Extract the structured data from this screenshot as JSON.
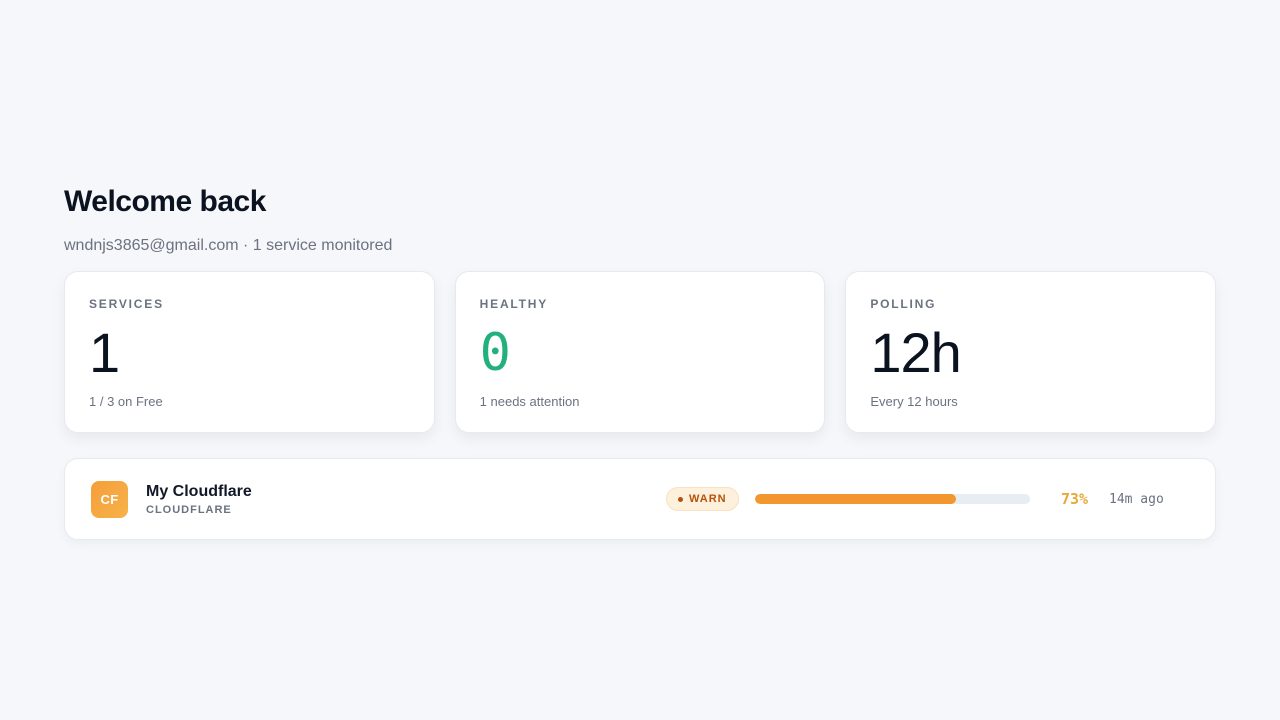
{
  "header": {
    "title": "Welcome back",
    "subtitle": "wndnjs3865@gmail.com · 1 service monitored"
  },
  "stats": [
    {
      "label": "SERVICES",
      "value": "1",
      "note": "1 / 3 on Free",
      "value_color": "#0b1220"
    },
    {
      "label": "HEALTHY",
      "value": "0",
      "note": "1 needs attention",
      "value_color": "#22b07d"
    },
    {
      "label": "POLLING",
      "value": "12h",
      "note": "Every 12 hours",
      "value_color": "#0b1220"
    }
  ],
  "services": [
    {
      "avatar_text": "CF",
      "name": "My Cloudflare",
      "provider": "CLOUDFLARE",
      "status": "WARN",
      "status_color": "#b45309",
      "usage_percent": 73,
      "usage_label": "73%",
      "usage_color": "#f2962e",
      "last_checked": "14m ago"
    }
  ]
}
